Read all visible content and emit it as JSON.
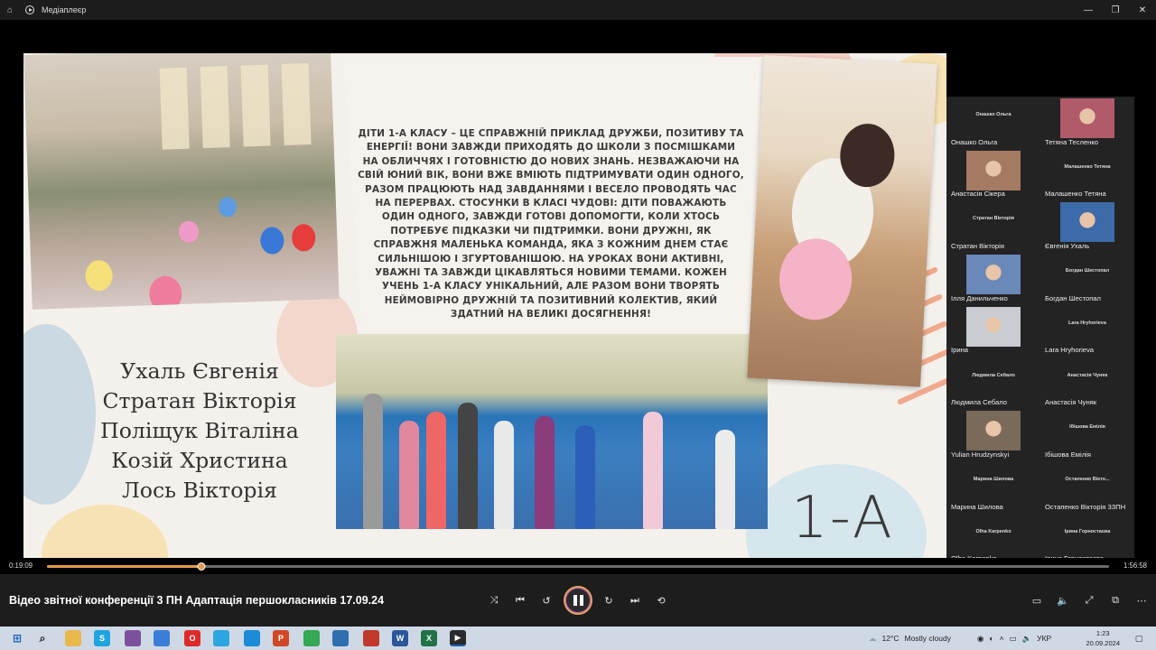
{
  "window": {
    "title": "Медіаплеєр",
    "home_icon": "home-icon",
    "controls": [
      "minimize-icon",
      "maximize-icon",
      "close-icon"
    ]
  },
  "slide": {
    "paragraph": "ДІТИ 1-А КЛАСУ – ЦЕ СПРАВЖНІЙ ПРИКЛАД ДРУЖБИ, ПОЗИТИВУ ТА ЕНЕРГІЇ! ВОНИ ЗАВЖДИ ПРИХОДЯТЬ ДО ШКОЛИ З ПОСМІШКАМИ НА ОБЛИЧЧЯХ І ГОТОВНІСТЮ ДО НОВИХ ЗНАНЬ. НЕЗВАЖАЮЧИ НА СВІЙ ЮНИЙ ВІК, ВОНИ ВЖЕ ВМІЮТЬ ПІДТРИМУВАТИ ОДИН ОДНОГО, РАЗОМ ПРАЦЮЮТЬ НАД ЗАВДАННЯМИ І ВЕСЕЛО ПРОВОДЯТЬ ЧАС НА ПЕРЕРВАХ. СТОСУНКИ В КЛАСІ ЧУДОВІ: ДІТИ ПОВАЖАЮТЬ ОДИН ОДНОГО, ЗАВЖДИ ГОТОВІ ДОПОМОГТИ, КОЛИ ХТОСЬ ПОТРЕБУЄ ПІДКАЗКИ ЧИ ПІДТРИМКИ. ВОНИ ДРУЖНІ, ЯК СПРАВЖНЯ МАЛЕНЬКА КОМАНДА, ЯКА З КОЖНИМ ДНЕМ СТАЄ СИЛЬНІШОЮ І ЗГУРТОВАНІШОЮ. НА УРОКАХ ВОНИ АКТИВНІ, УВАЖНІ ТА ЗАВЖДИ ЦІКАВЛЯТЬСЯ НОВИМИ ТЕМАМИ. КОЖЕН УЧЕНЬ 1-А КЛАСУ УНІКАЛЬНИЙ, АЛЕ РАЗОМ ВОНИ ТВОРЯТЬ НЕЙМОВІРНО ДРУЖНІЙ ТА ПОЗИТИВНИЙ КОЛЕКТИВ, ЯКИЙ ЗДАТНИЙ НА ВЕЛИКІ ДОСЯГНЕННЯ!",
    "names": [
      "Ухаль Євгенія",
      "Стратан Вікторія",
      "Поліщук Віталіна",
      "Козій Христина",
      "Лось Вікторія"
    ],
    "class_label": "1-А"
  },
  "participants": [
    {
      "top": "Онашко Ольга",
      "name": "Онашко Ольга",
      "video": false
    },
    {
      "top": "",
      "name": "Тетяна Тесленко",
      "video": true,
      "color": "#b05a6a"
    },
    {
      "top": "",
      "name": "Анастасія Сікера",
      "video": true,
      "color": "#a57a62"
    },
    {
      "top": "Малашенко Тетяна",
      "name": "Малашенко Тетяна",
      "video": false
    },
    {
      "top": "Стратан Вікторія",
      "name": "Стратан Вікторія",
      "video": false
    },
    {
      "top": "",
      "name": "Євгенія Ухаль",
      "video": true,
      "color": "#3d6aa8"
    },
    {
      "top": "",
      "name": "Ілля Данильченко",
      "video": true,
      "color": "#6a88b8"
    },
    {
      "top": "Богдан Шестопал",
      "name": "Богдан Шестопал",
      "video": false
    },
    {
      "top": "",
      "name": "Ірина",
      "video": true,
      "color": "#c8ccd0"
    },
    {
      "top": "Lara Hryhorieva",
      "name": "Lara Hryhorieva",
      "video": false
    },
    {
      "top": "Людмила Себало",
      "name": "Людмила Себало",
      "video": false
    },
    {
      "top": "Анастасія Чуняк",
      "name": "Анастасія Чуняк",
      "video": false
    },
    {
      "top": "",
      "name": "Yulian Hrudzynskyi",
      "video": true,
      "color": "#7a6a5a"
    },
    {
      "top": "Ібішова Емілія",
      "name": "Ібішова Емілія",
      "video": false
    },
    {
      "top": "Марина Шилова",
      "name": "Марина Шилова",
      "video": false
    },
    {
      "top": "Остапенко Вікто...",
      "name": "Остапенко Вікторія 3ЗПН",
      "video": false
    },
    {
      "top": "Olha Karpenko",
      "name": "Olha Karpenko",
      "video": false
    },
    {
      "top": "Ірина Горностаєва",
      "name": "Ірина Горностаєва",
      "video": false
    }
  ],
  "player": {
    "elapsed": "0:19:09",
    "total": "1:56:58",
    "progress_fraction": 0.145,
    "media_title": "Відео звітної  конференції 3 ПН Адаптація першокласників 17.09.24",
    "accent": "#e29a50"
  },
  "taskbar": {
    "weather_temp": "12°C",
    "weather_text": "Mostly cloudy",
    "lang": "УКР",
    "time": "1:23",
    "date": "20.09.2024"
  }
}
